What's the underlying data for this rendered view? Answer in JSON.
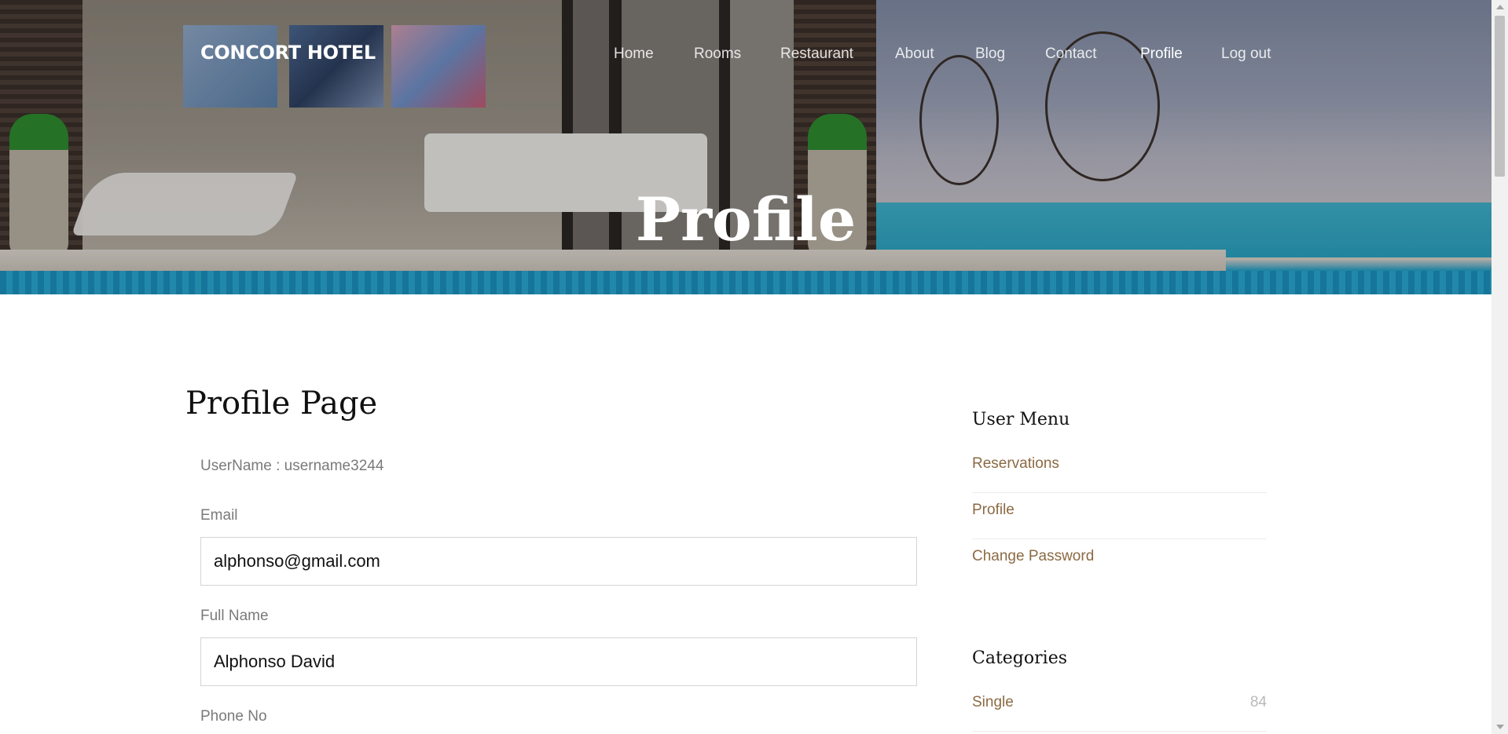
{
  "brand": "CONCORT HOTEL",
  "nav": {
    "items": [
      {
        "label": "Home"
      },
      {
        "label": "Rooms"
      },
      {
        "label": "Restaurant"
      },
      {
        "label": "About"
      },
      {
        "label": "Blog"
      },
      {
        "label": "Contact"
      },
      {
        "label": "Profile",
        "active": true
      },
      {
        "label": "Log out"
      }
    ]
  },
  "hero": {
    "title": "Profile"
  },
  "main": {
    "title": "Profile Page",
    "username": "UserName : username3244",
    "fields": {
      "email": {
        "label": "Email",
        "value": "alphonso@gmail.com"
      },
      "full_name": {
        "label": "Full Name",
        "value": "Alphonso David"
      },
      "phone": {
        "label": "Phone No"
      }
    }
  },
  "sidebar": {
    "user_menu": {
      "heading": "User Menu",
      "items": [
        {
          "label": "Reservations"
        },
        {
          "label": "Profile"
        },
        {
          "label": "Change Password"
        }
      ]
    },
    "categories": {
      "heading": "Categories",
      "items": [
        {
          "label": "Single",
          "count": "84"
        }
      ]
    }
  },
  "colors": {
    "link_brown": "#8b6a43",
    "text_dark": "#111111",
    "text_muted": "#7a7a7a",
    "border": "#d4d4d4"
  }
}
